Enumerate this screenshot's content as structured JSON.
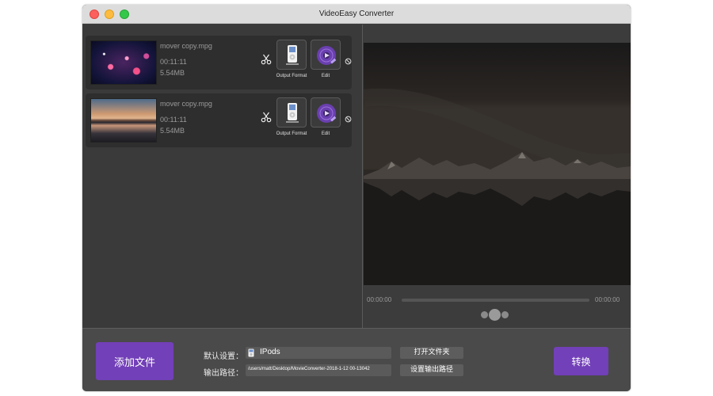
{
  "window": {
    "title": "VideoEasy Converter"
  },
  "files": [
    {
      "name": "mover copy.mpg",
      "duration": "00:11:11",
      "size": "5.54MB",
      "output_format_label": "Output Format",
      "edit_label": "Edit"
    },
    {
      "name": "mover copy.mpg",
      "duration": "00:11:11",
      "size": "5.54MB",
      "output_format_label": "Output Format",
      "edit_label": "Edit"
    }
  ],
  "player": {
    "current_time": "00:00:00",
    "total_time": "00:00:00",
    "progress": 0
  },
  "bottom": {
    "add_file": "添加文件",
    "default_setting_label": "默认设置：",
    "default_format": "IPods",
    "output_path_label": "输出路径：",
    "output_path": "/users/matt/Desktop/MovieConverter-2018-1-12 00-13042",
    "open_folder": "打开文件夹",
    "set_output_path": "设置输出路径",
    "convert": "转换"
  },
  "colors": {
    "accent": "#7240b8",
    "panel": "#3a3a3a",
    "card": "#2e2e2e"
  }
}
